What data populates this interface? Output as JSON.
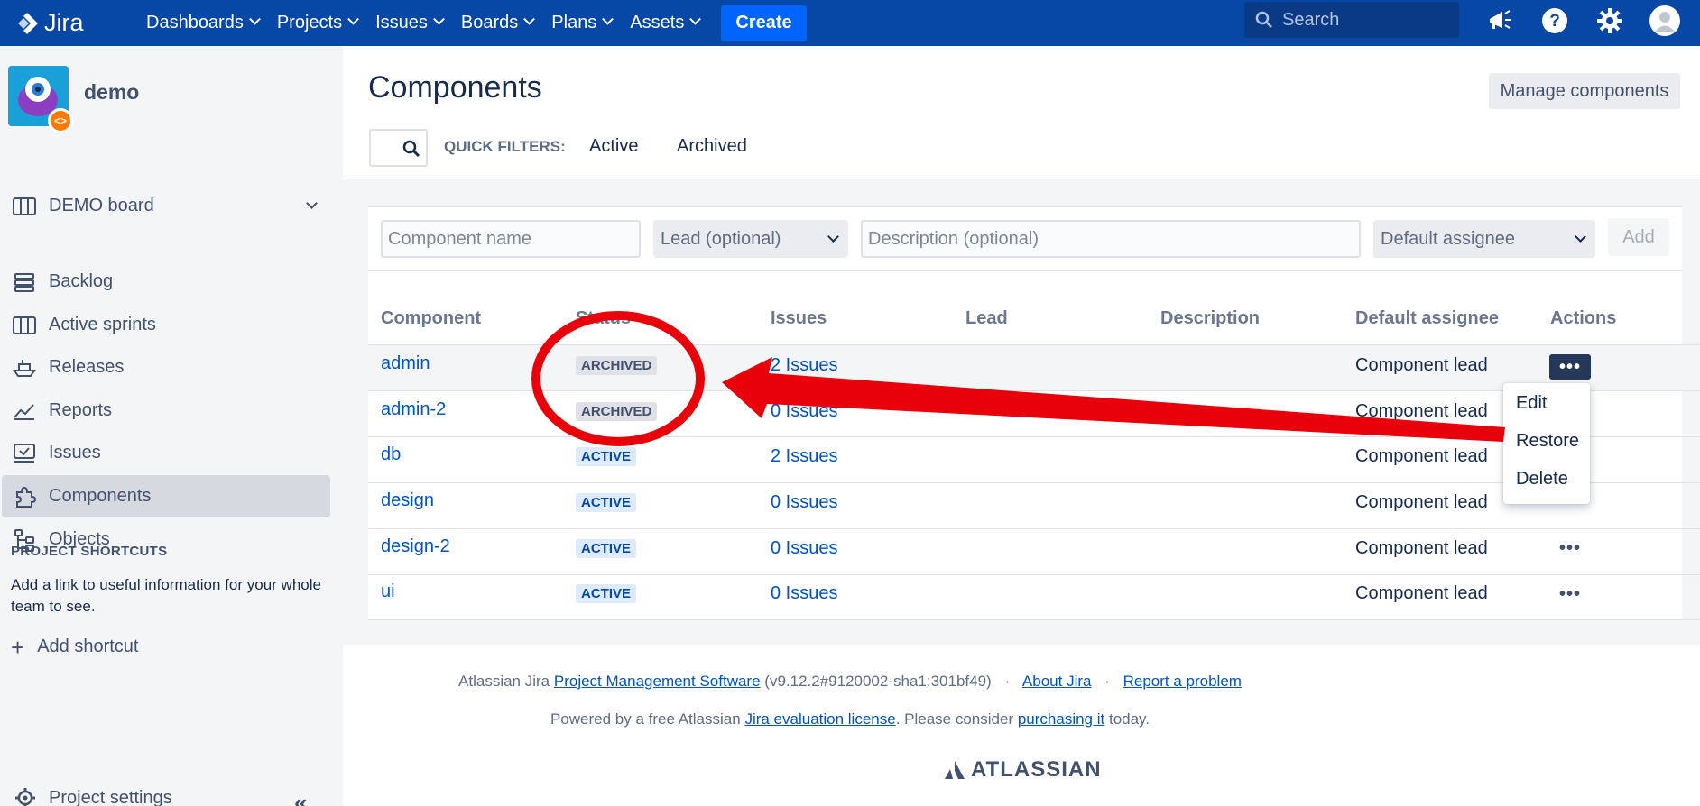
{
  "topnav": {
    "logo": "Jira",
    "items": [
      {
        "label": "Dashboards"
      },
      {
        "label": "Projects"
      },
      {
        "label": "Issues"
      },
      {
        "label": "Boards"
      },
      {
        "label": "Plans"
      },
      {
        "label": "Assets"
      }
    ],
    "create_label": "Create",
    "search_placeholder": "Search"
  },
  "sidebar": {
    "project_name": "demo",
    "board_label": "DEMO board",
    "items": [
      {
        "label": "Backlog",
        "icon": "backlog-icon"
      },
      {
        "label": "Active sprints",
        "icon": "board-icon"
      },
      {
        "label": "Releases",
        "icon": "ship-icon"
      },
      {
        "label": "Reports",
        "icon": "chart-icon"
      },
      {
        "label": "Issues",
        "icon": "issues-icon"
      },
      {
        "label": "Components",
        "icon": "puzzle-icon",
        "active": true
      },
      {
        "label": "Objects",
        "icon": "tree-icon"
      }
    ],
    "shortcuts_title": "PROJECT SHORTCUTS",
    "shortcuts_text": "Add a link to useful information for your whole team to see.",
    "add_shortcut": "Add shortcut",
    "project_settings": "Project settings"
  },
  "main": {
    "title": "Components",
    "manage_button": "Manage components",
    "quick_filters_label": "QUICK FILTERS:",
    "quick_filters": [
      "Active",
      "Archived"
    ],
    "form": {
      "name_placeholder": "Component name",
      "lead_placeholder": "Lead (optional)",
      "description_placeholder": "Description (optional)",
      "assignee_placeholder": "Default assignee",
      "add_label": "Add"
    },
    "columns": [
      "Component",
      "Status",
      "Issues",
      "Lead",
      "Description",
      "Default assignee",
      "Actions"
    ],
    "rows": [
      {
        "component": "admin",
        "status": "ARCHIVED",
        "issues": "2 Issues",
        "lead": "",
        "description": "",
        "assignee": "Component lead"
      },
      {
        "component": "admin-2",
        "status": "ARCHIVED",
        "issues": "0 Issues",
        "lead": "",
        "description": "",
        "assignee": "Component lead"
      },
      {
        "component": "db",
        "status": "ACTIVE",
        "issues": "2 Issues",
        "lead": "",
        "description": "",
        "assignee": "Component lead"
      },
      {
        "component": "design",
        "status": "ACTIVE",
        "issues": "0 Issues",
        "lead": "",
        "description": "",
        "assignee": "Component lead"
      },
      {
        "component": "design-2",
        "status": "ACTIVE",
        "issues": "0 Issues",
        "lead": "",
        "description": "",
        "assignee": "Component lead"
      },
      {
        "component": "ui",
        "status": "ACTIVE",
        "issues": "0 Issues",
        "lead": "",
        "description": "",
        "assignee": "Component lead"
      }
    ],
    "actions_menu": [
      "Edit",
      "Restore",
      "Delete"
    ],
    "dots": "•••"
  },
  "footer": {
    "line1_prefix": "Atlassian Jira",
    "line1_link": "Project Management Software",
    "line1_version": "(v9.12.2#9120002-sha1:301bf49)",
    "about": "About Jira",
    "report": "Report a problem",
    "line2_prefix": "Powered by a free Atlassian",
    "line2_link": "Jira evaluation license",
    "line2_mid": ". Please consider",
    "line2_link2": "purchasing it",
    "line2_suffix": "today.",
    "brand": "ATLASSIAN",
    "sep": "·"
  },
  "colors": {
    "nav_bg": "#0747a6",
    "link": "#0052cc",
    "annotation": "#e8000b"
  }
}
